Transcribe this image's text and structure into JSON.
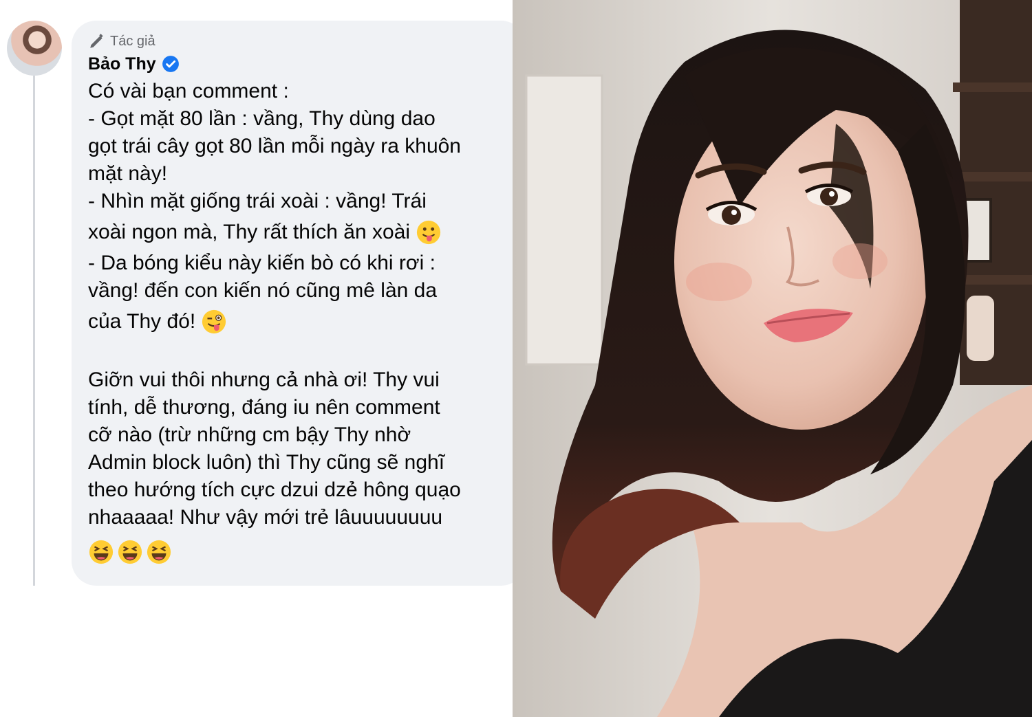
{
  "comment": {
    "badge_label": "Tác giả",
    "author_name": "Bảo Thy",
    "lines": [
      "Có vài bạn comment :",
      "- Gọt mặt 80 lần : vầng, Thy dùng dao",
      "gọt trái cây gọt 80 lần mỗi ngày ra khuôn",
      "mặt này!",
      "- Nhìn mặt giống trái xoài : vầng! Trái",
      "xoài ngon mà, Thy rất thích ăn xoài",
      "- Da bóng kiểu này kiến bò có khi rơi :",
      "vầng! đến con kiến nó cũng mê làn da",
      "của Thy đó!",
      "Giỡn vui thôi nhưng cả nhà ơi! Thy vui",
      "tính, dễ thương, đáng iu nên comment",
      "cỡ nào (trừ những cm bậy Thy nhờ",
      "Admin block luôn) thì Thy cũng sẽ nghĩ",
      "theo hướng tích cực dzui dzẻ hông quạo",
      "nhaaaaa! Như vậy mới trẻ lâuuuuuuuu"
    ],
    "emojis": {
      "line6": "tongue-out-emoji",
      "line9": "winking-tongue-emoji",
      "last_row": [
        "laughing-emoji",
        "laughing-emoji",
        "laughing-emoji"
      ]
    }
  },
  "colors": {
    "bubble_bg": "#f0f2f5",
    "verified_blue": "#1877f2",
    "muted_text": "#65676b"
  }
}
